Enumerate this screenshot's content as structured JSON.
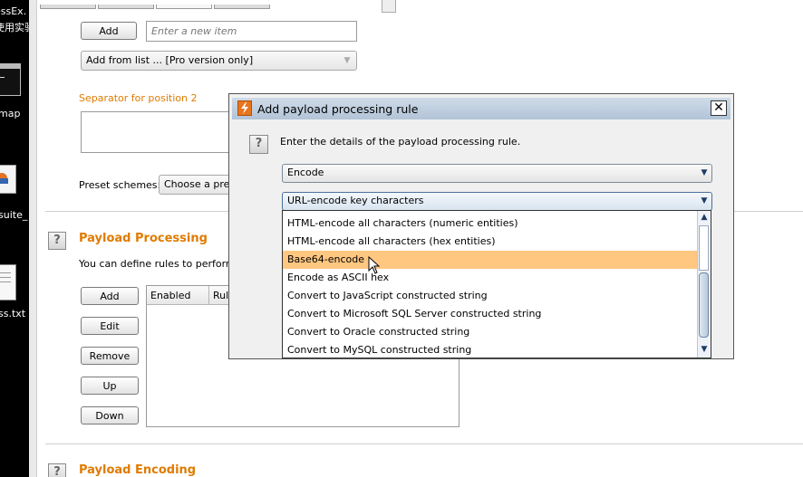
{
  "desktop": {
    "icons": [
      {
        "label_line1": "essEx.",
        "label_line2": "使用实验"
      },
      {
        "label": "map"
      },
      {
        "label": "suite_"
      },
      {
        "label": "ss.txt"
      }
    ]
  },
  "payload_options": {
    "add_label": "Add",
    "item_placeholder": "Enter a new item",
    "add_from_list_label": "Add from list ... [Pro version only]",
    "separator_label": "Separator for position 2",
    "preset_label": "Preset schemes:",
    "preset_value": "Choose a pres"
  },
  "processing": {
    "title": "Payload Processing",
    "description": "You can define rules to perform va",
    "buttons": [
      "Add",
      "Edit",
      "Remove",
      "Up",
      "Down"
    ],
    "columns": [
      "Enabled",
      "Rul"
    ]
  },
  "encoding": {
    "title": "Payload Encoding"
  },
  "dialog": {
    "title": "Add payload processing rule",
    "instruction": "Enter the details of the payload processing rule.",
    "type_value": "Encode",
    "encode_value": "URL-encode key characters",
    "options": [
      "HTML-encode all characters (numeric entities)",
      "HTML-encode all characters (hex entities)",
      "Base64-encode",
      "Encode as ASCII hex",
      "Convert to JavaScript constructed string",
      "Convert to Microsoft SQL Server constructed string",
      "Convert to Oracle constructed string",
      "Convert to MySQL constructed string"
    ],
    "highlighted_option": "Base64-encode",
    "close_glyph": "✕"
  },
  "colors": {
    "accent": "#e07b00",
    "highlight": "#ffc780",
    "titlebar": "#b2c4d8"
  }
}
